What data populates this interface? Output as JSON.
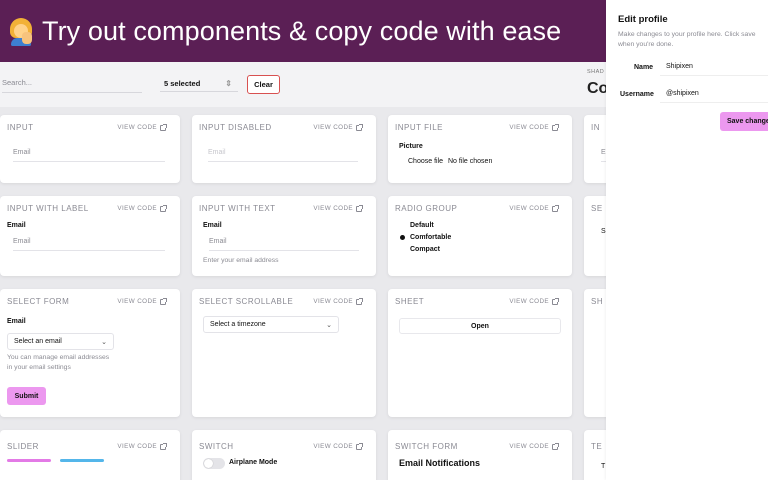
{
  "banner": {
    "title": "Try out components & copy code with ease",
    "emoji": "person-tipping-hand-emoji"
  },
  "toolbar": {
    "search_placeholder": "Search...",
    "selected_label": "5 selected",
    "clear_label": "Clear",
    "section_label": "SHAD",
    "heading_partial": "Co"
  },
  "view_code_label": "VIEW CODE",
  "cards": {
    "input": {
      "title": "INPUT",
      "placeholder": "Email"
    },
    "input_disabled": {
      "title": "INPUT DISABLED",
      "placeholder": "Email"
    },
    "input_file": {
      "title": "INPUT FILE",
      "label": "Picture",
      "button": "Choose file",
      "status": "No file chosen"
    },
    "input_partial_1": {
      "title": "IN",
      "placeholder": "E"
    },
    "input_with_label": {
      "title": "INPUT WITH LABEL",
      "label": "Email",
      "placeholder": "Email"
    },
    "input_with_text": {
      "title": "INPUT WITH TEXT",
      "label": "Email",
      "placeholder": "Email",
      "hint": "Enter your email address"
    },
    "radio_group": {
      "title": "RADIO GROUP",
      "options": [
        "Default",
        "Comfortable",
        "Compact"
      ],
      "selected": "Comfortable"
    },
    "partial_2": {
      "title": "SE",
      "value": "S"
    },
    "select_form": {
      "title": "SELECT FORM",
      "label": "Email",
      "select_placeholder": "Select an email",
      "hint_line1": "You can manage email addresses",
      "hint_line2": "in your email settings",
      "submit": "Submit"
    },
    "select_scrollable": {
      "title": "SELECT SCROLLABLE",
      "placeholder": "Select a timezone"
    },
    "sheet": {
      "title": "SHEET",
      "button": "Open"
    },
    "partial_3": {
      "title": "SH"
    },
    "slider": {
      "title": "SLIDER"
    },
    "switch": {
      "title": "SWITCH",
      "label": "Airplane Mode",
      "on": false
    },
    "switch_form": {
      "title": "SWITCH FORM",
      "label": "Email Notifications"
    },
    "partial_4": {
      "title": "TE",
      "value": "T"
    }
  },
  "panel": {
    "title": "Edit profile",
    "description": "Make changes to your profile here. Click save when you're done.",
    "name_label": "Name",
    "name_value": "Shipixen",
    "username_label": "Username",
    "username_value": "@shipixen",
    "save_label": "Save changes"
  },
  "colors": {
    "banner": "#5b1f55",
    "accent_pink": "#ec98ef",
    "slider_pink": "#e37ae6",
    "slider_blue": "#54b6ea",
    "clear_border": "#d85151"
  }
}
